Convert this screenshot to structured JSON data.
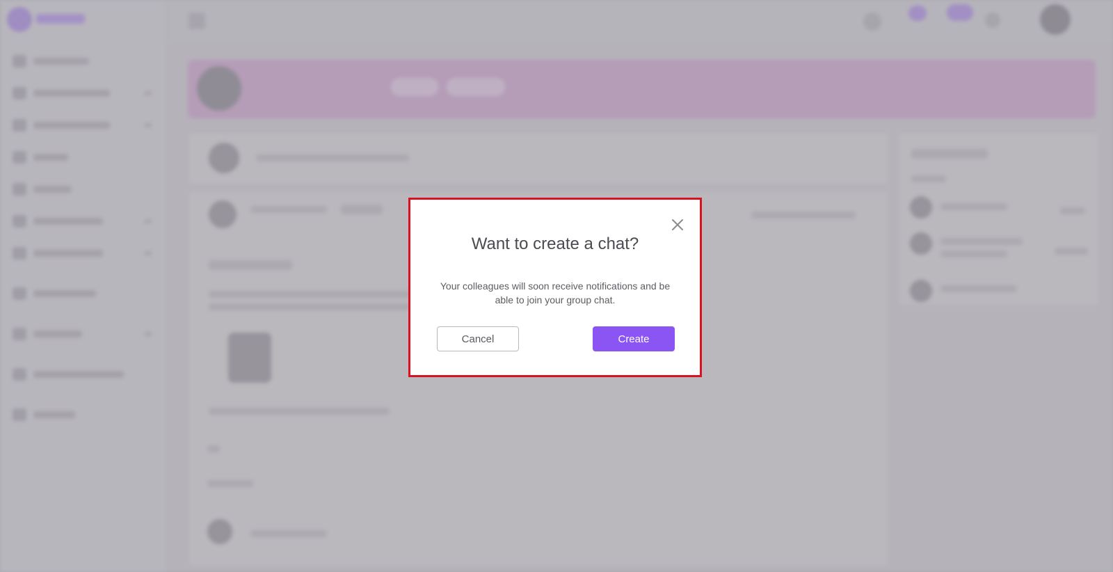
{
  "dialog": {
    "title": "Want to create a chat?",
    "message": "Your colleagues will soon receive notifications and be able to join your group chat.",
    "cancel_label": "Cancel",
    "create_label": "Create",
    "close_icon": "close-icon"
  },
  "colors": {
    "primary_button": "#8a55f2",
    "highlight_border": "#d8121f"
  }
}
